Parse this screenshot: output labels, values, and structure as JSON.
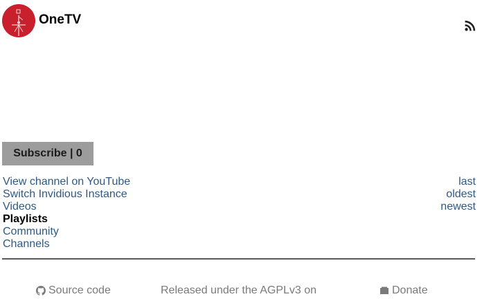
{
  "channel": {
    "name": "OneTV"
  },
  "icons": {
    "avatar": "channel-avatar",
    "rss": "rss-icon",
    "github": "github-icon",
    "donate": "wallet-icon"
  },
  "colors": {
    "avatar_bg": "#c8202d",
    "link": "#2e5984",
    "subscribe_bg": "#9c9c9c",
    "footer_text": "#7a7a7a"
  },
  "subscribe": {
    "label": "Subscribe | 0"
  },
  "nav": {
    "items": [
      {
        "label": "View channel on YouTube",
        "active": false
      },
      {
        "label": "Switch Invidious Instance",
        "active": false
      },
      {
        "label": "Videos",
        "active": false
      },
      {
        "label": "Playlists",
        "active": true
      },
      {
        "label": "Community",
        "active": false
      },
      {
        "label": "Channels",
        "active": false
      }
    ]
  },
  "sort": {
    "items": [
      {
        "label": "last"
      },
      {
        "label": "oldest"
      },
      {
        "label": "newest"
      }
    ]
  },
  "footer": {
    "source_code": "Source code",
    "released": "Released under the AGPLv3 on",
    "donate": "Donate"
  }
}
